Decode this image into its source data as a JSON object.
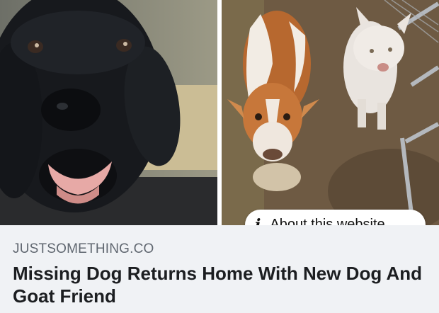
{
  "link_preview": {
    "about_label": "About this website",
    "domain": "JUSTSOMETHING.CO",
    "headline": "Missing Dog Returns Home With New Dog And Goat Friend"
  },
  "images": {
    "left": "black-labrador-photo",
    "right": "goat-and-white-dog-photo"
  },
  "icons": {
    "info": "i"
  },
  "colors": {
    "caption_bg": "#f0f2f5",
    "domain_text": "#606770",
    "headline_text": "#1c1e21"
  }
}
